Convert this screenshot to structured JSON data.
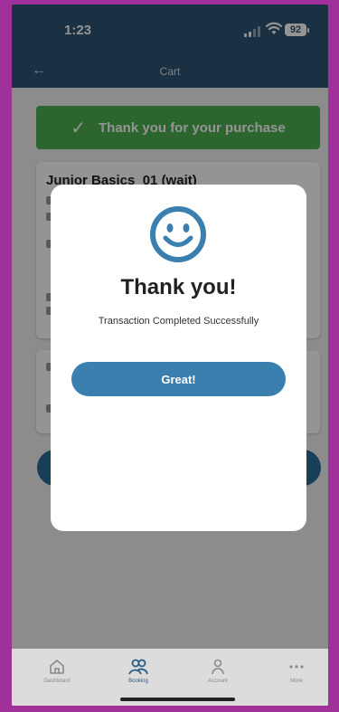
{
  "status_bar": {
    "time": "1:23",
    "battery": "92"
  },
  "header": {
    "back_icon": "arrow-left-icon",
    "title": "Cart"
  },
  "banner": {
    "icon": "check-icon",
    "text": "Thank you for your purchase"
  },
  "card": {
    "title": "Junior Basics_01 (wait)"
  },
  "modal": {
    "icon": "smiley-icon",
    "title": "Thank you!",
    "subtitle": "Transaction Completed Successfully",
    "button_label": "Great!"
  },
  "bottom_nav": [
    {
      "label": "Dashboard",
      "icon": "home-icon",
      "active": false
    },
    {
      "label": "Booking",
      "icon": "people-icon",
      "active": true
    },
    {
      "label": "Account",
      "icon": "person-icon",
      "active": false
    },
    {
      "label": "More",
      "icon": "more-icon",
      "active": false
    }
  ],
  "colors": {
    "header": "#2b5572",
    "success": "#4caf50",
    "primary_button": "#3a7fae",
    "modal_icon": "#3a7fae"
  }
}
